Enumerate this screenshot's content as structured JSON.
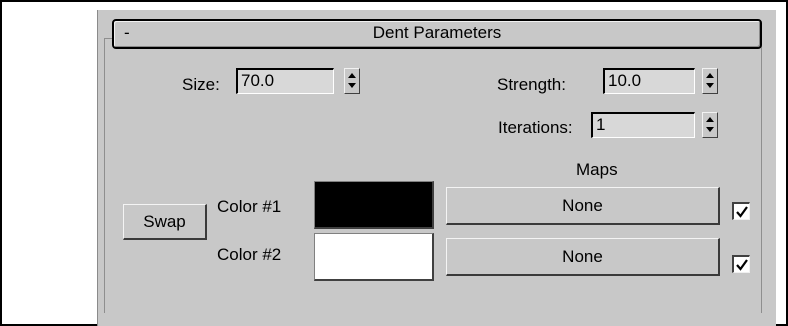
{
  "rollout": {
    "toggle": "-",
    "title": "Dent Parameters"
  },
  "params": {
    "size_label": "Size:",
    "size_value": "70.0",
    "strength_label": "Strength:",
    "strength_value": "10.0",
    "iterations_label": "Iterations:",
    "iterations_value": "1"
  },
  "maps": {
    "heading": "Maps",
    "swap_label": "Swap",
    "color1_label": "Color #1",
    "color1_value": "#000000",
    "color2_label": "Color #2",
    "color2_value": "#ffffff",
    "map1_label": "None",
    "map1_enabled": true,
    "map2_label": "None",
    "map2_enabled": true
  }
}
